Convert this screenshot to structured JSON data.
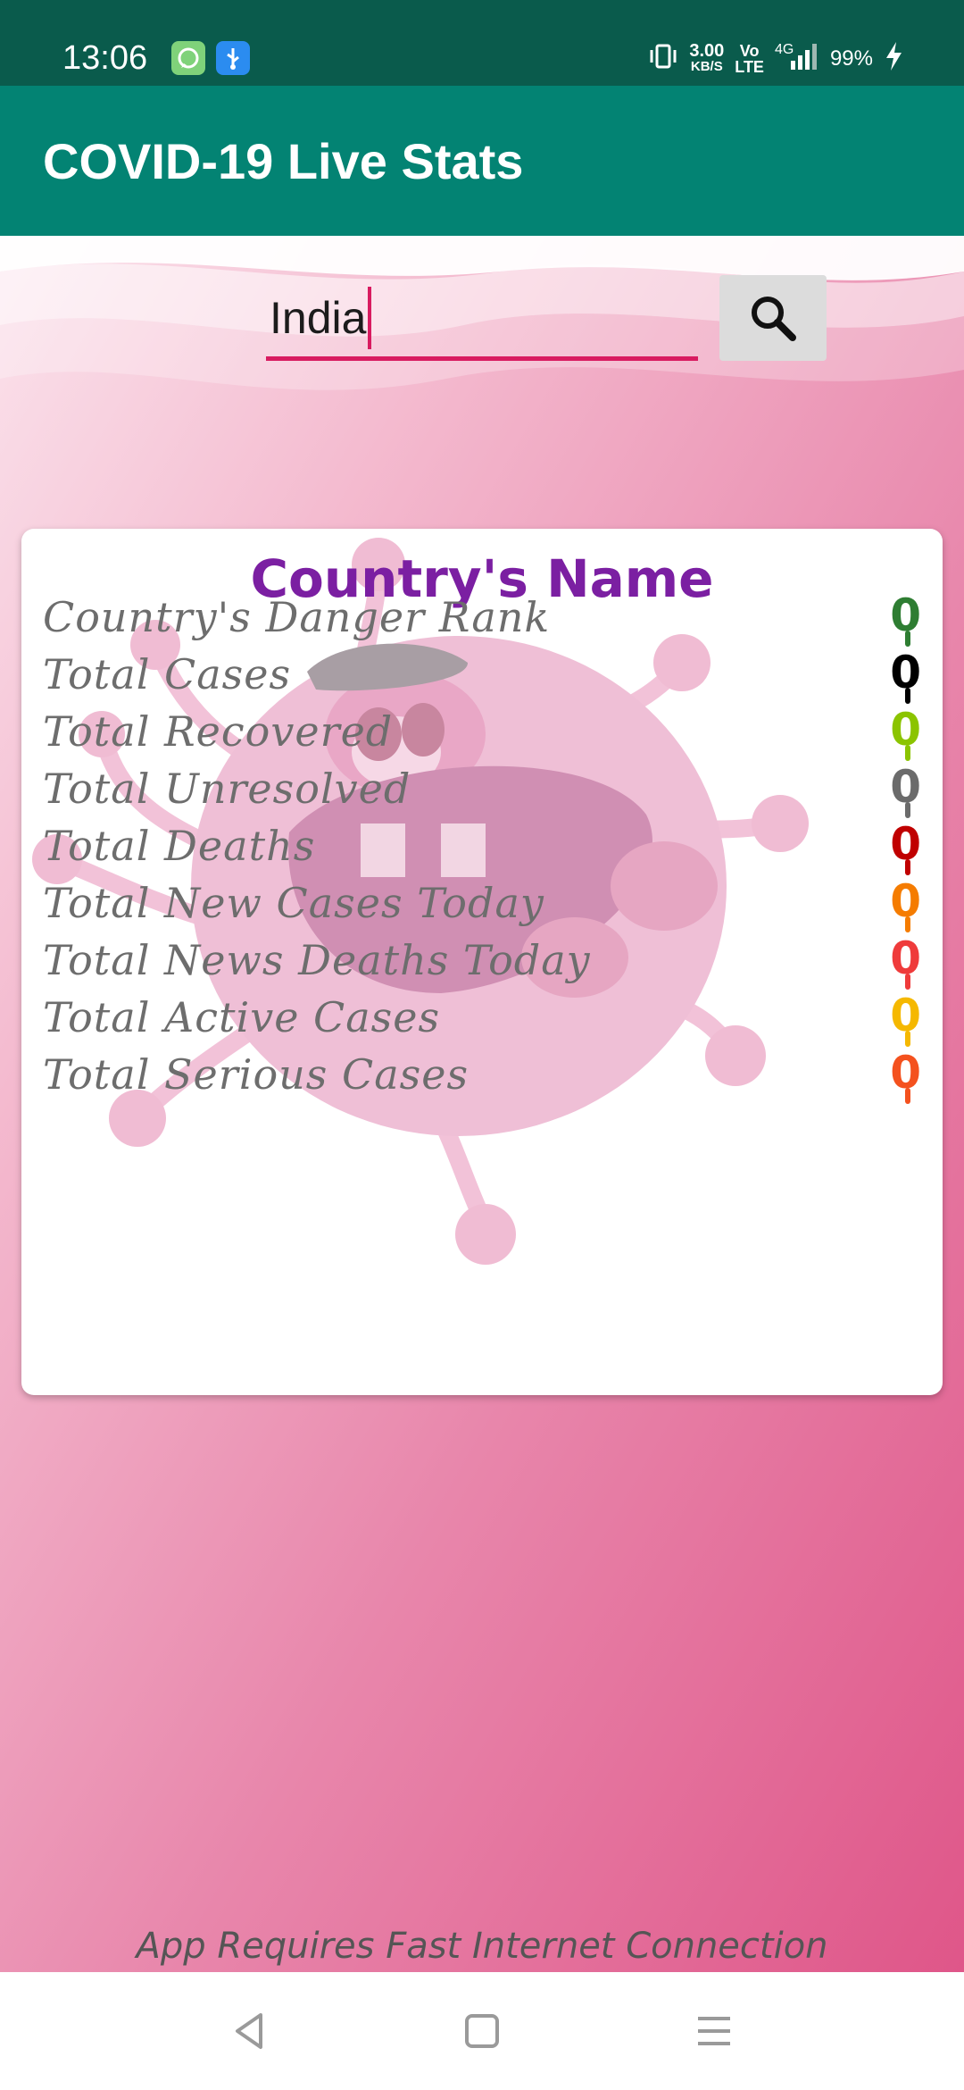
{
  "status_bar": {
    "time": "13:06",
    "net_speed": "3.00",
    "net_unit": "KB/S",
    "volte_top": "Vo",
    "volte_bottom": "LTE",
    "network": "4G",
    "battery": "99%",
    "icons": [
      "chat-notification-icon",
      "usb-icon",
      "vibrate-icon",
      "signal-icon",
      "charging-icon"
    ]
  },
  "app_bar": {
    "title": "COVID-19 Live Stats"
  },
  "search": {
    "value": "India",
    "button_icon": "search-icon"
  },
  "card": {
    "title": "Country's Name",
    "rows": [
      {
        "label": "Country's Danger Rank",
        "value": "0",
        "color": "#2e7d32"
      },
      {
        "label": "Total Cases",
        "value": "0",
        "color": "#000000"
      },
      {
        "label": "Total Recovered",
        "value": "0",
        "color": "#8bc400"
      },
      {
        "label": "Total Unresolved",
        "value": "0",
        "color": "#6b6b6b"
      },
      {
        "label": "Total Deaths",
        "value": "0",
        "color": "#c00000"
      },
      {
        "label": "Total New Cases Today",
        "value": "0",
        "color": "#f57c00"
      },
      {
        "label": "Total News Deaths Today",
        "value": "0",
        "color": "#ef3b3b"
      },
      {
        "label": "Total Active Cases",
        "value": "0",
        "color": "#f5b800"
      },
      {
        "label": "Total Serious Cases",
        "value": "0",
        "color": "#f4511e"
      }
    ]
  },
  "footer": {
    "note": "App Requires Fast Internet Connection"
  },
  "nav_bar": {
    "icons": [
      "back-icon",
      "home-icon",
      "menu-icon"
    ]
  },
  "colors": {
    "status_bar": "#0a5b4c",
    "app_bar": "#038373",
    "accent": "#d81b60",
    "title": "#7b1fa2"
  }
}
